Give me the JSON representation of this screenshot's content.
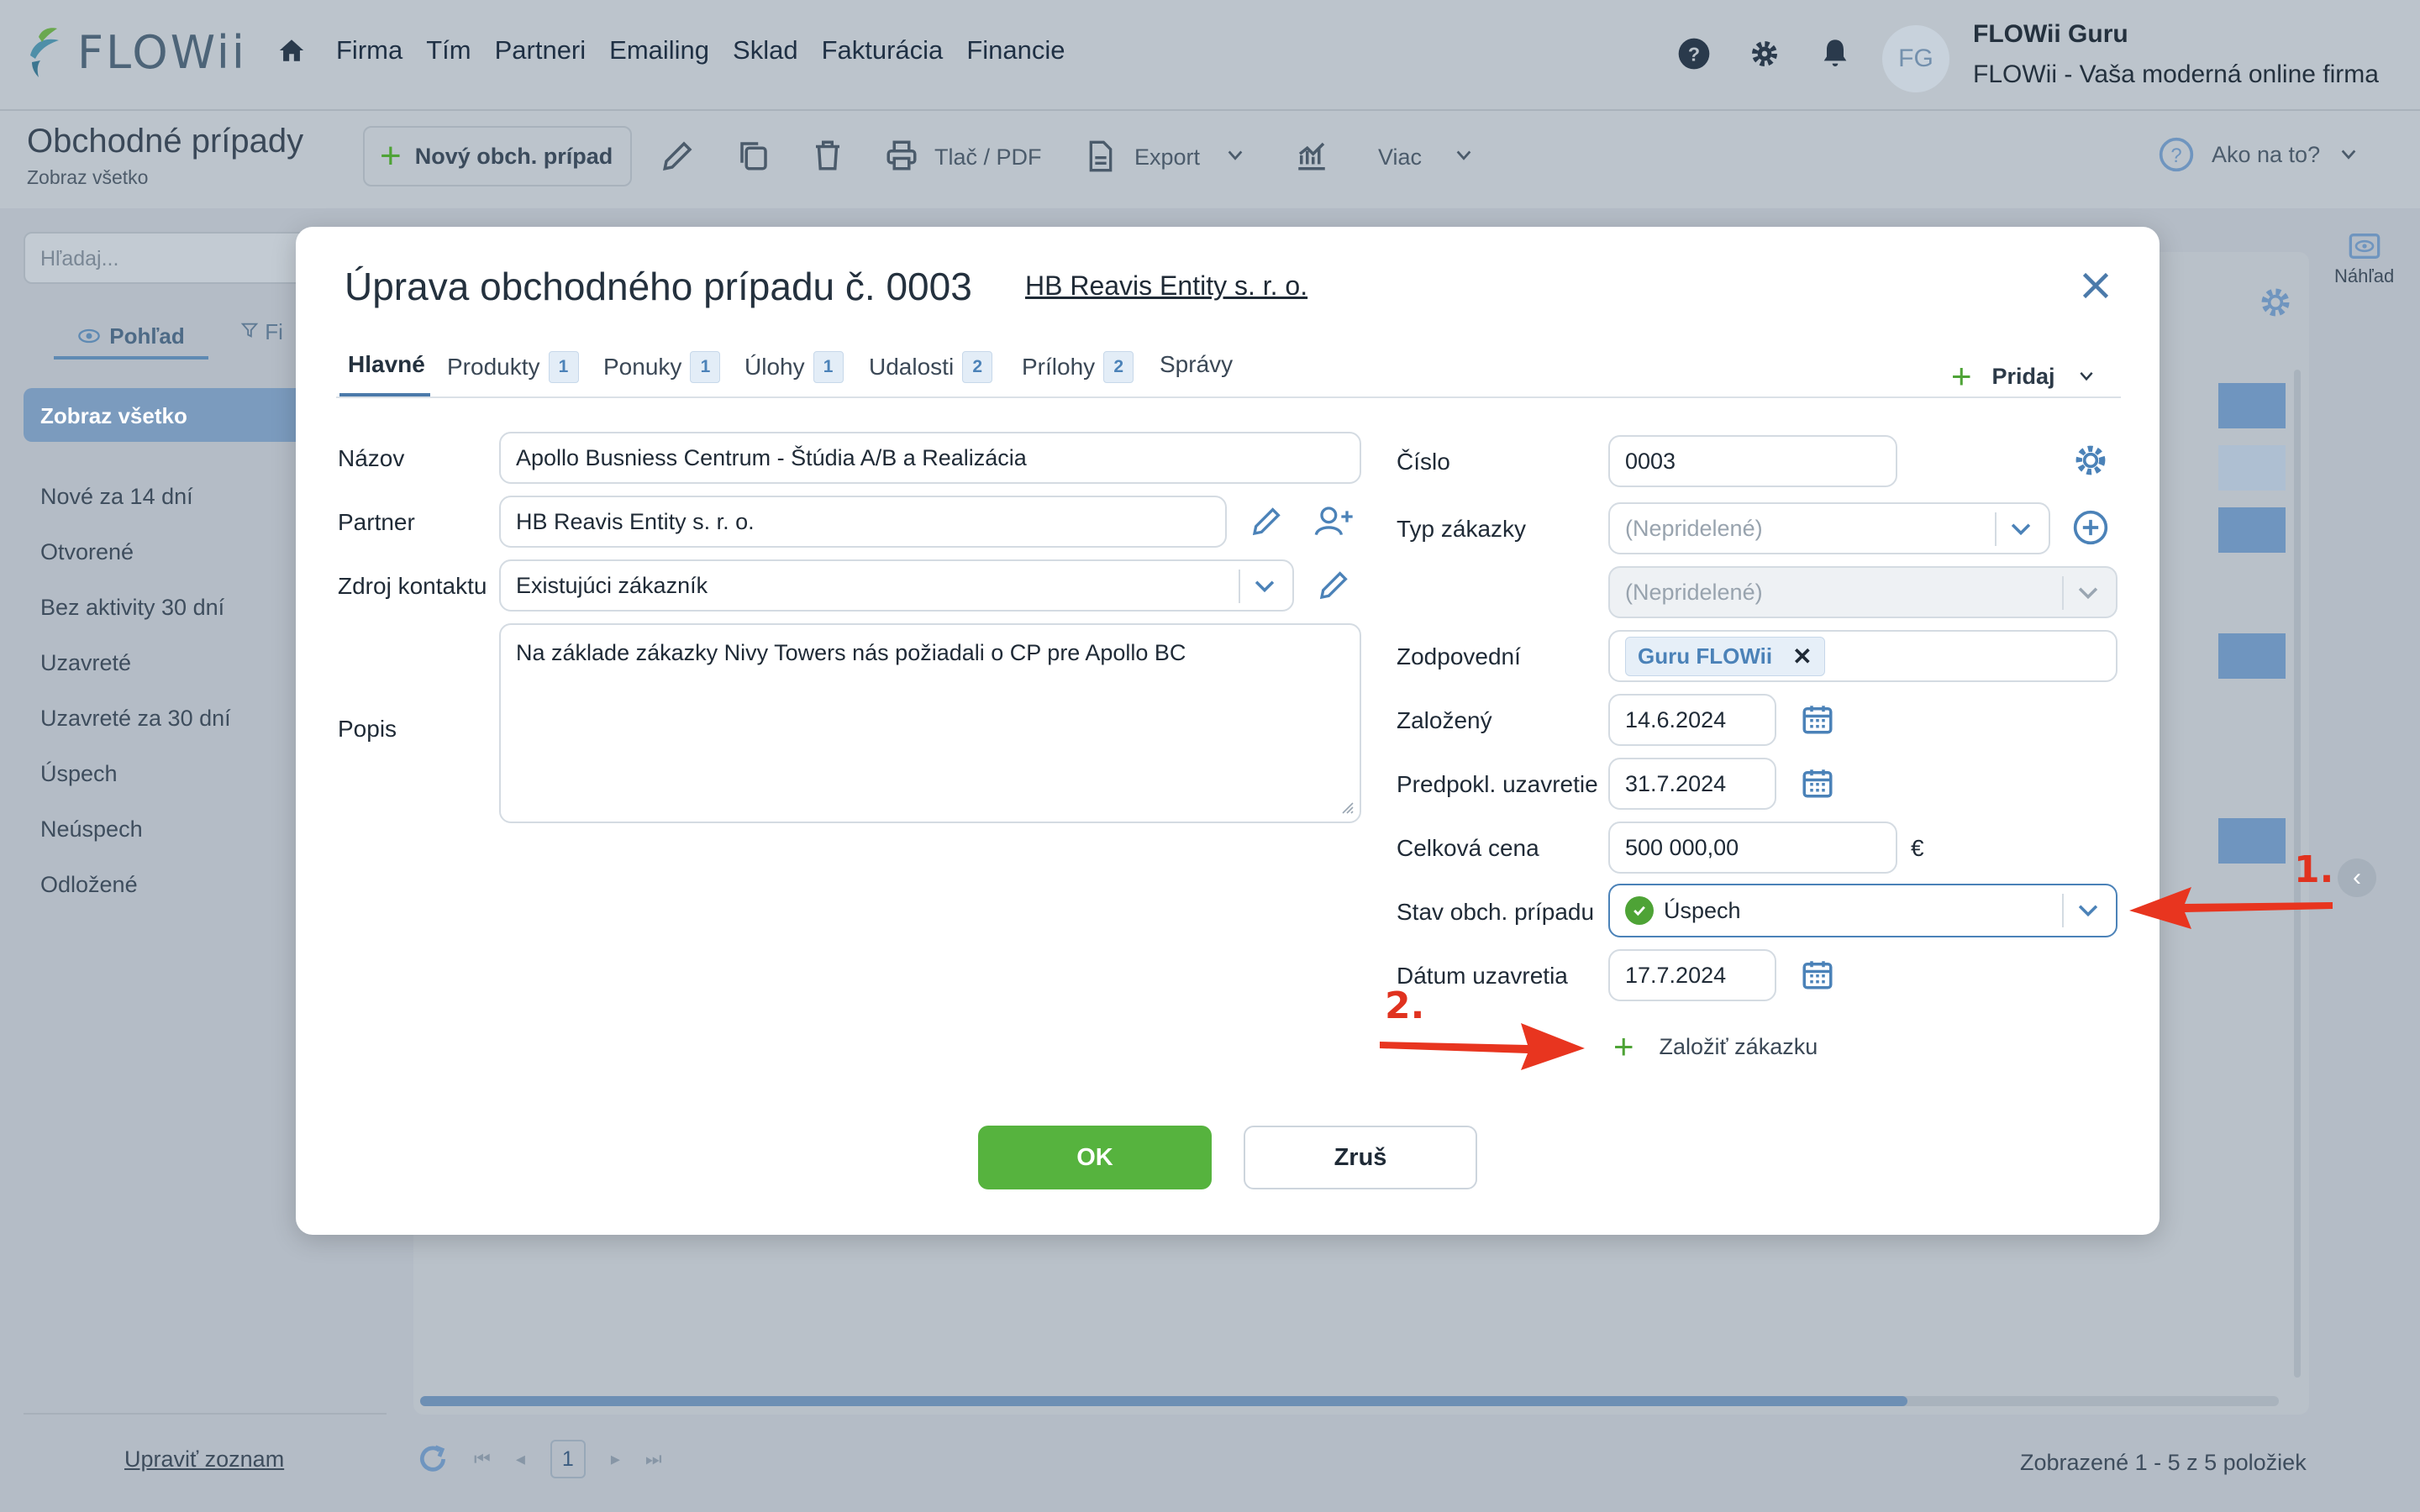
{
  "app": {
    "logo": "FLOWii",
    "nav": [
      "Firma",
      "Tím",
      "Partneri",
      "Emailing",
      "Sklad",
      "Fakturácia",
      "Financie"
    ],
    "user": {
      "initials": "FG",
      "name": "FLOWii Guru",
      "company": "FLOWii - Vaša moderná online firma"
    }
  },
  "toolbar": {
    "title": "Obchodné prípady",
    "subtitle": "Zobraz všetko",
    "new_label": "Nový obch. prípad",
    "print_label": "Tlač / PDF",
    "export_label": "Export",
    "more_label": "Viac",
    "help_label": "Ako na to?"
  },
  "sidebar": {
    "search_placeholder": "Hľadaj...",
    "view_tab": "Pohľad",
    "filter_tab": "Fi",
    "show_all": "Zobraz všetko",
    "items": [
      "Nové za 14 dní",
      "Otvorené",
      "Bez aktivity 30 dní",
      "Uzavreté",
      "Uzavreté za 30 dní",
      "Úspech",
      "Neúspech",
      "Odložené"
    ],
    "edit_list": "Upraviť zoznam"
  },
  "grid": {
    "preview_label": "Náhľad",
    "page": "1",
    "footer": "Zobrazené 1 - 5 z 5 položiek"
  },
  "modal": {
    "title": "Úprava obchodného prípadu č. 0003",
    "partner_link": "HB Reavis Entity s. r. o.",
    "tabs": [
      {
        "label": "Hlavné"
      },
      {
        "label": "Produkty",
        "badge": "1"
      },
      {
        "label": "Ponuky",
        "badge": "1"
      },
      {
        "label": "Úlohy",
        "badge": "1"
      },
      {
        "label": "Udalosti",
        "badge": "2"
      },
      {
        "label": "Prílohy",
        "badge": "2"
      },
      {
        "label": "Správy"
      }
    ],
    "add_label": "Pridaj",
    "left": {
      "name_label": "Názov",
      "name_value": "Apollo Busniess Centrum - Štúdia A/B a Realizácia",
      "partner_label": "Partner",
      "partner_value": "HB Reavis Entity s. r. o.",
      "source_label": "Zdroj kontaktu",
      "source_value": "Existujúci zákazník",
      "desc_label": "Popis",
      "desc_value": "Na základe zákazky Nivy Towers nás požiadali o CP pre Apollo BC"
    },
    "right": {
      "number_label": "Číslo",
      "number_value": "0003",
      "order_type_label": "Typ zákazky",
      "order_type_value": "(Nepridelené)",
      "order_sub_value": "(Nepridelené)",
      "responsible_label": "Zodpovední",
      "responsible_tag": "Guru FLOWii",
      "created_label": "Založený",
      "created_value": "14.6.2024",
      "expected_close_label": "Predpokl. uzavretie",
      "expected_close_value": "31.7.2024",
      "total_label": "Celková cena",
      "total_value": "500 000,00",
      "currency": "€",
      "status_label": "Stav obch. prípadu",
      "status_value": "Úspech",
      "close_date_label": "Dátum uzavretia",
      "close_date_value": "17.7.2024",
      "create_order_label": "Založiť zákazku"
    },
    "ok_label": "OK",
    "cancel_label": "Zruš"
  },
  "annotations": {
    "arrow_1": "1.",
    "arrow_2": "2."
  },
  "colors": {
    "accent_green": "#56b33e",
    "link_blue": "#4b7aaa",
    "annotation_red": "#e0321f",
    "overlay": "#b4bcc6"
  }
}
